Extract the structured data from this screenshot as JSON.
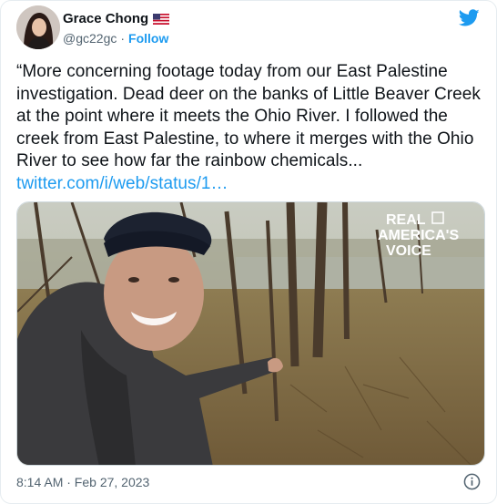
{
  "author": {
    "display_name": "Grace Chong",
    "handle": "@gc22gc",
    "separator": "·",
    "follow_label": "Follow",
    "avatar_icon": "profile-photo",
    "flag_icon": "us-flag-icon"
  },
  "tweet": {
    "text": "“More concerning footage today from our East Palestine investigation. Dead deer on the banks of Little Beaver Creek at the point where it meets the Ohio River. I followed the creek from East Palestine, to where it merges with the Ohio River to see how far the rainbow chemicals...",
    "link": "twitter.com/i/web/status/1…"
  },
  "media": {
    "watermark_line1": "REAL",
    "watermark_line2": "AMERICA'S",
    "watermark_line3": "VOICE"
  },
  "footer": {
    "timestamp": "8:14 AM · Feb 27, 2023"
  },
  "colors": {
    "accent": "#1d9bf0",
    "text": "#0f1419",
    "muted": "#536471"
  }
}
